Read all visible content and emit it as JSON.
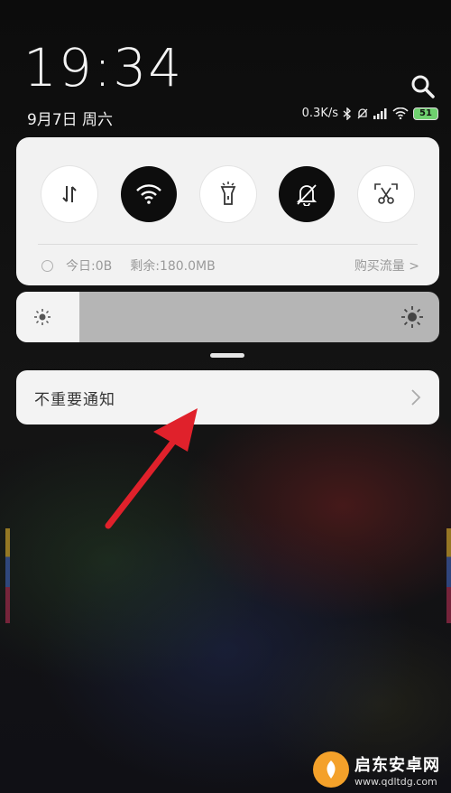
{
  "status": {
    "time": "19:34",
    "date": "9月7日 周六",
    "network_speed": "0.3K/s",
    "battery": "51"
  },
  "quick_settings": {
    "toggles": [
      {
        "name": "mobile-data",
        "icon": "data-arrows-icon",
        "state": "off"
      },
      {
        "name": "wifi",
        "icon": "wifi-icon",
        "state": "on"
      },
      {
        "name": "flashlight",
        "icon": "flashlight-icon",
        "state": "off"
      },
      {
        "name": "silent",
        "icon": "bell-off-icon",
        "state": "on"
      },
      {
        "name": "screenshot",
        "icon": "scissors-icon",
        "state": "off"
      }
    ],
    "data_usage": {
      "today": "今日:0B",
      "remaining": "剩余:180.0MB",
      "buy": "购买流量 >"
    }
  },
  "brightness": {
    "level_percent": 15
  },
  "notification": {
    "title": "不重要通知"
  },
  "watermark": {
    "name": "启东安卓网",
    "url": "www.qdltdg.com"
  },
  "colors": {
    "panel": "#f2f2f2",
    "toggle_on": "#0d0d0d",
    "arrow": "#e0212b",
    "battery": "#6fd06f"
  }
}
